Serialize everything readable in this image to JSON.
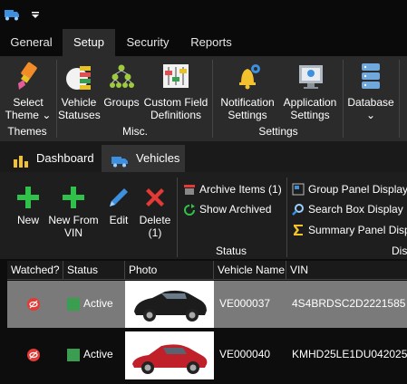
{
  "quick_access": {
    "app_icon": "truck-icon",
    "dropdown_icon": "chevron-down-icon"
  },
  "main_tabs": [
    {
      "label": "General",
      "active": false
    },
    {
      "label": "Setup",
      "active": true
    },
    {
      "label": "Security",
      "active": false
    },
    {
      "label": "Reports",
      "active": false
    }
  ],
  "ribbon": {
    "select_theme": {
      "line1": "Select",
      "line2": "Theme",
      "icon": "paint-brush-icon"
    },
    "vehicle_statuses": {
      "line1": "Vehicle",
      "line2": "Statuses",
      "icon": "status-chart-icon"
    },
    "groups": {
      "label": "Groups",
      "icon": "hierarchy-icon"
    },
    "custom_field": {
      "line1": "Custom Field",
      "line2": "Definitions",
      "icon": "sliders-icon"
    },
    "notification": {
      "line1": "Notification",
      "line2": "Settings",
      "icon": "bell-gear-icon"
    },
    "application": {
      "line1": "Application",
      "line2": "Settings",
      "icon": "monitor-gear-icon"
    },
    "database": {
      "label": "Database",
      "icon": "database-icon"
    },
    "groups_labels": {
      "themes": "Themes",
      "misc": "Misc.",
      "settings": "Settings"
    }
  },
  "doc_tabs": [
    {
      "label": "Dashboard",
      "icon": "dashboard-icon",
      "active": false
    },
    {
      "label": "Vehicles",
      "icon": "truck-icon",
      "active": true
    }
  ],
  "toolbar": {
    "new": {
      "label": "New",
      "icon": "plus-icon"
    },
    "new_from_vin": {
      "line1": "New From",
      "line2": "VIN",
      "icon": "plus-icon"
    },
    "edit": {
      "label": "Edit",
      "icon": "pencil-icon"
    },
    "delete": {
      "line1": "Delete",
      "line2": "(1)",
      "icon": "x-icon"
    },
    "archive_items": "Archive Items (1)",
    "show_archived": "Show Archived",
    "status_group": "Status",
    "group_panel": "Group Panel Display",
    "search_box": "Search Box Display",
    "summary_panel": "Summary Panel Disp",
    "display_group": "Dis"
  },
  "grid": {
    "columns": [
      "Watched?",
      "Status",
      "Photo",
      "Vehicle Name",
      "VIN"
    ],
    "rows": [
      {
        "status": "Active",
        "vehicle_name": "VE000037",
        "vin": "4S4BRDSC2D2221585",
        "car_color": "black",
        "selected": true
      },
      {
        "status": "Active",
        "vehicle_name": "VE000040",
        "vin": "KMHD25LE1DU042025",
        "car_color": "red",
        "selected": false
      }
    ],
    "colors": {
      "status_green": "#3a9d4f",
      "watch_red": "#e53935"
    }
  }
}
